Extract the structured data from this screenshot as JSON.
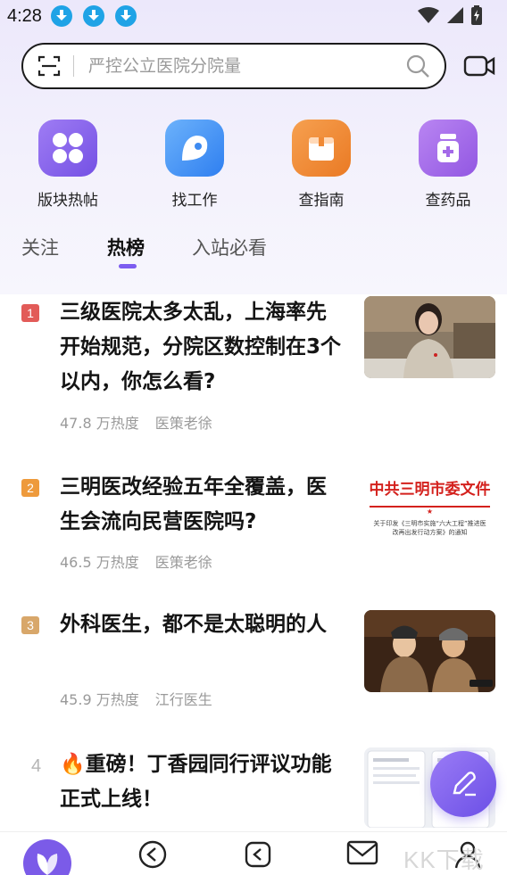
{
  "status_bar": {
    "time": "4:28"
  },
  "search": {
    "placeholder": "严控公立医院分院量"
  },
  "quick_entries": [
    {
      "label": "版块热帖",
      "icon": "grid-bubbles-icon",
      "color": "#8a63ea"
    },
    {
      "label": "找工作",
      "icon": "job-badge-icon",
      "color": "#3e8bf1"
    },
    {
      "label": "查指南",
      "icon": "guide-book-icon",
      "color": "#f08a36"
    },
    {
      "label": "查药品",
      "icon": "medicine-bottle-icon",
      "color": "#a46ae8"
    }
  ],
  "tabs": [
    {
      "label": "关注",
      "active": false
    },
    {
      "label": "热榜",
      "active": true
    },
    {
      "label": "入站必看",
      "active": false
    }
  ],
  "feed": [
    {
      "rank": "1",
      "rank_color": "#e25b58",
      "title": "三级医院太多太乱，上海率先开始规范，分院区数控制在3个以内，你怎么看?",
      "heat": "47.8 万热度",
      "author": "医策老徐"
    },
    {
      "rank": "2",
      "rank_color": "#ee9a3c",
      "title": "三明医改经验五年全覆盖，医生会流向民营医院吗?",
      "heat": "46.5 万热度",
      "author": "医策老徐",
      "thumb_title": "中共三明市委文件",
      "thumb_sub": "关于印发《三明市实施“六大工程”推进医改再出发行动方案》的通知"
    },
    {
      "rank": "3",
      "rank_color": "#d8a76a",
      "title": "外科医生，都不是太聪明的人",
      "heat": "45.9 万热度",
      "author": "江行医生"
    },
    {
      "rank": "4",
      "title_prefix": "🔥",
      "title": "重磅！丁香园同行评议功能正式上线！",
      "heat": "",
      "author": ""
    }
  ],
  "colors": {
    "accent": "#7c5cf0",
    "home_nav": "#7b5be8"
  },
  "watermark": "KK下载"
}
